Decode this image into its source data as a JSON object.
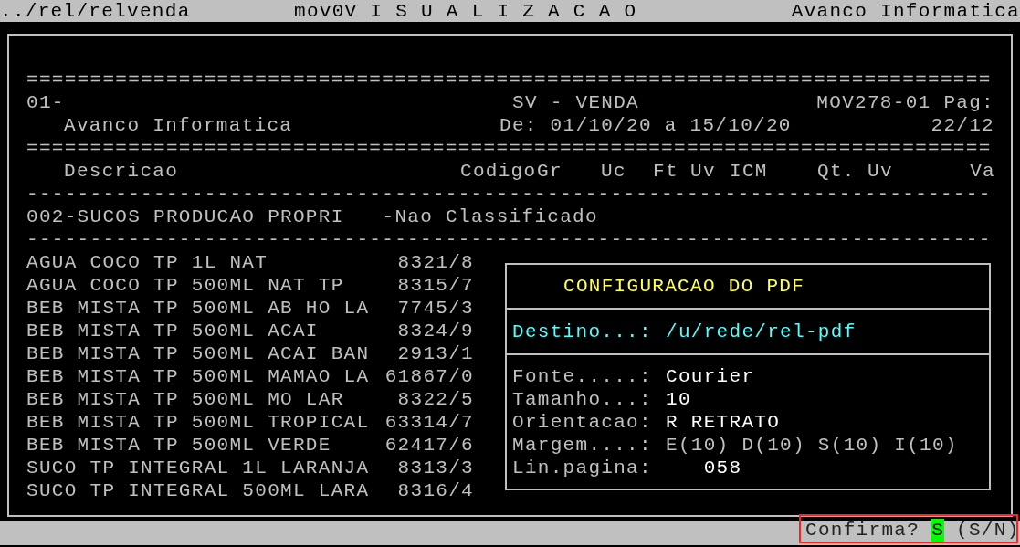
{
  "top_bar": {
    "path": "../rel/relvenda",
    "title": "mov0V I S U A L I Z A C A O",
    "company": "Avanco Informatica"
  },
  "report": {
    "double_rule": "============================================================================",
    "single_rule": "----------------------------------------------------------------------------",
    "header": [
      {
        "left": "01-",
        "center": "SV - VENDA",
        "right": "MOV278-01 Pag:"
      },
      {
        "left": "Avanco Informatica",
        "center": "De: 01/10/20 a 15/10/20",
        "right": "22/12"
      }
    ],
    "columns": [
      "Descricao",
      "Codigo",
      "Gr",
      "Uc",
      "Ft",
      "Uv",
      "ICM",
      "Qt.",
      "Uv",
      "Va"
    ],
    "group": {
      "name": "002-SUCOS PRODUCAO PROPRI",
      "classification": "-Nao Classificado"
    },
    "items": [
      {
        "description": "AGUA COCO TP 1L NAT",
        "code": "8321/8"
      },
      {
        "description": "AGUA COCO TP 500ML NAT TP",
        "code": "8315/7"
      },
      {
        "description": "BEB MISTA TP 500ML AB HO LA",
        "code": "7745/3"
      },
      {
        "description": "BEB MISTA TP 500ML ACAI",
        "code": "8324/9"
      },
      {
        "description": "BEB MISTA TP 500ML ACAI BAN",
        "code": "2913/1"
      },
      {
        "description": "BEB MISTA TP 500ML MAMAO LA",
        "code": "61867/0"
      },
      {
        "description": "BEB MISTA TP 500ML MO LAR",
        "code": "8322/5"
      },
      {
        "description": "BEB MISTA TP 500ML TROPICAL",
        "code": "63314/7"
      },
      {
        "description": "BEB MISTA TP 500ML VERDE",
        "code": "62417/6"
      },
      {
        "description": "SUCO TP INTEGRAL 1L LARANJA",
        "code": "8313/3"
      },
      {
        "description": "SUCO TP INTEGRAL 500ML LARA",
        "code": "8316/4"
      }
    ]
  },
  "dialog": {
    "title": "CONFIGURACAO DO PDF",
    "destination": {
      "label": "Destino...:",
      "value": "/u/rede/rel-pdf"
    },
    "fields": [
      {
        "label": "Fonte.....:",
        "value": "Courier",
        "kind": "value"
      },
      {
        "label": "Tamanho...:",
        "value": "10",
        "kind": "value"
      },
      {
        "label": "Orientacao:",
        "value": "R RETRATO",
        "kind": "value"
      },
      {
        "label": "Margem....:",
        "value": "E(10) D(10) S(10) I(10)",
        "kind": "options"
      },
      {
        "label": "Lin.pagina:",
        "value": "   058",
        "kind": "value"
      }
    ]
  },
  "prompt": {
    "question": "Confirma?",
    "answer": "S",
    "choices": "(S/N)"
  }
}
